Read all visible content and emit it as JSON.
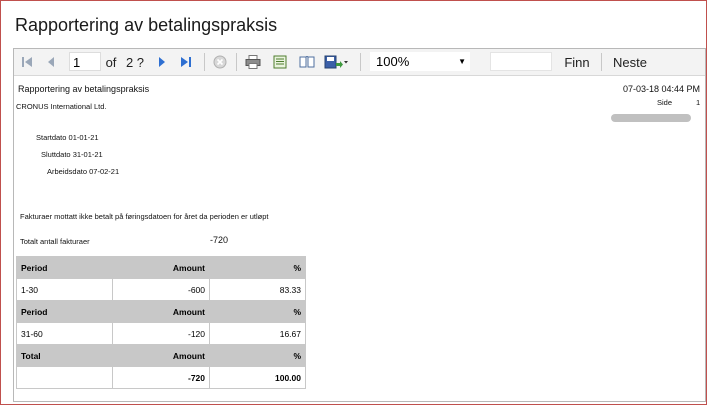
{
  "window": {
    "title": "Rapportering av betalingspraksis"
  },
  "toolbar": {
    "current_page": "1",
    "of_label": "of",
    "total_pages": "2 ?",
    "zoom": "100%",
    "find_label": "Finn",
    "next_label": "Neste",
    "icons": [
      "first-page-icon",
      "previous-page-icon",
      "next-page-icon",
      "last-page-icon",
      "stop-icon",
      "print-icon",
      "print-layout-icon",
      "page-setup-icon",
      "export-icon"
    ]
  },
  "report": {
    "heading": "Rapportering av betalingspraksis",
    "company": "CRONUS International Ltd.",
    "datetime": "07-03-18 04:44 PM",
    "page_label": "Side",
    "page_number": "1",
    "start_date": "Startdato 01-01-21",
    "end_date": "Sluttdato 31-01-21",
    "work_date": "Arbeidsdato 07-02-21",
    "description": "Fakturaer mottatt ikke betalt på føringsdatoen for året da perioden er utløpt",
    "total_label": "Totalt antall fakturaer",
    "total_value": "-720",
    "table": [
      {
        "type": "header",
        "cells": [
          "Period",
          "Amount",
          "%"
        ]
      },
      {
        "type": "row",
        "cells": [
          "1-30",
          "-600",
          "83.33"
        ]
      },
      {
        "type": "header",
        "cells": [
          "Period",
          "Amount",
          "%"
        ]
      },
      {
        "type": "row",
        "cells": [
          "31-60",
          "-120",
          "16.67"
        ]
      },
      {
        "type": "header",
        "cells": [
          "Total",
          "Amount",
          "%"
        ]
      },
      {
        "type": "total",
        "cells": [
          "",
          "-720",
          "100.00"
        ]
      }
    ]
  }
}
